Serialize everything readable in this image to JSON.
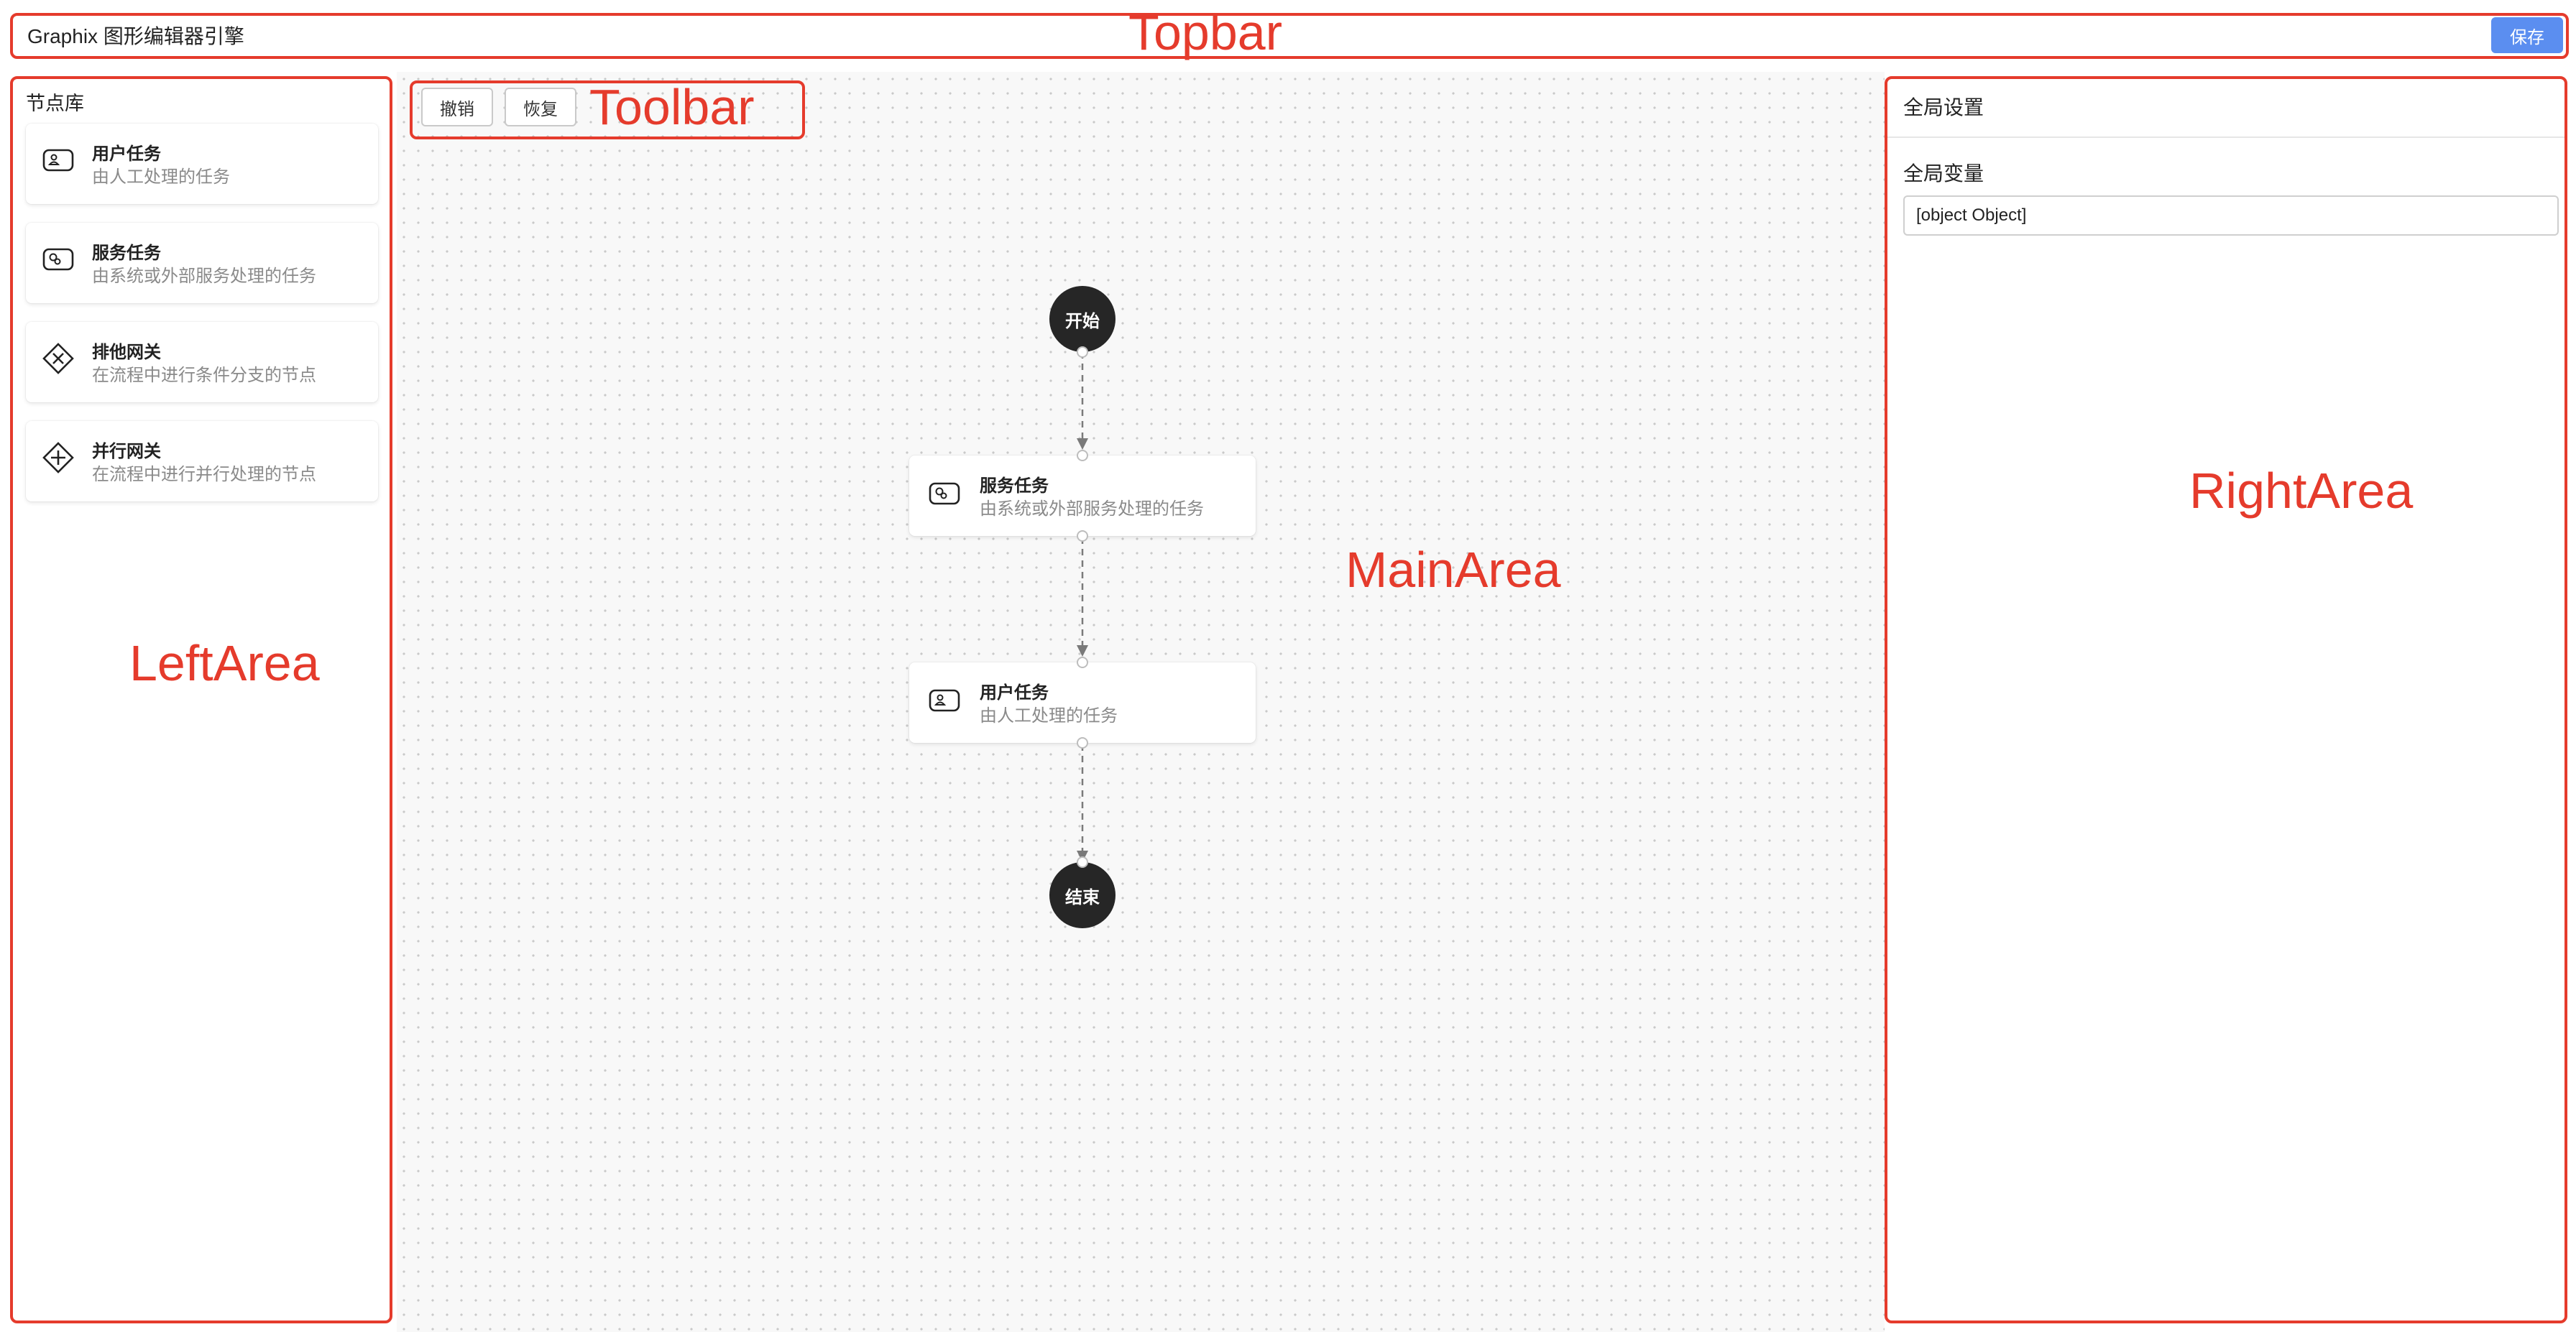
{
  "topbar": {
    "title": "Graphix 图形编辑器引擎",
    "save_label": "保存"
  },
  "left": {
    "title": "节点库",
    "items": [
      {
        "name": "用户任务",
        "desc": "由人工处理的任务",
        "icon": "user-task-icon"
      },
      {
        "name": "服务任务",
        "desc": "由系统或外部服务处理的任务",
        "icon": "service-task-icon"
      },
      {
        "name": "排他网关",
        "desc": "在流程中进行条件分支的节点",
        "icon": "exclusive-gateway-icon"
      },
      {
        "name": "并行网关",
        "desc": "在流程中进行并行处理的节点",
        "icon": "parallel-gateway-icon"
      }
    ]
  },
  "toolbar": {
    "undo_label": "撤销",
    "redo_label": "恢复"
  },
  "canvas": {
    "nodes": {
      "start": "开始",
      "service": {
        "name": "服务任务",
        "desc": "由系统或外部服务处理的任务"
      },
      "user": {
        "name": "用户任务",
        "desc": "由人工处理的任务"
      },
      "end": "结束"
    }
  },
  "right": {
    "title": "全局设置",
    "var_label": "全局变量",
    "var_value": "[object Object]"
  },
  "annotations": {
    "topbar": "Topbar",
    "toolbar": "Toolbar",
    "left": "LeftArea",
    "main": "MainArea",
    "right": "RightArea"
  },
  "colors": {
    "annotation": "#e53b2c",
    "save_button": "#5b8ef0",
    "node_dark": "#262626"
  }
}
